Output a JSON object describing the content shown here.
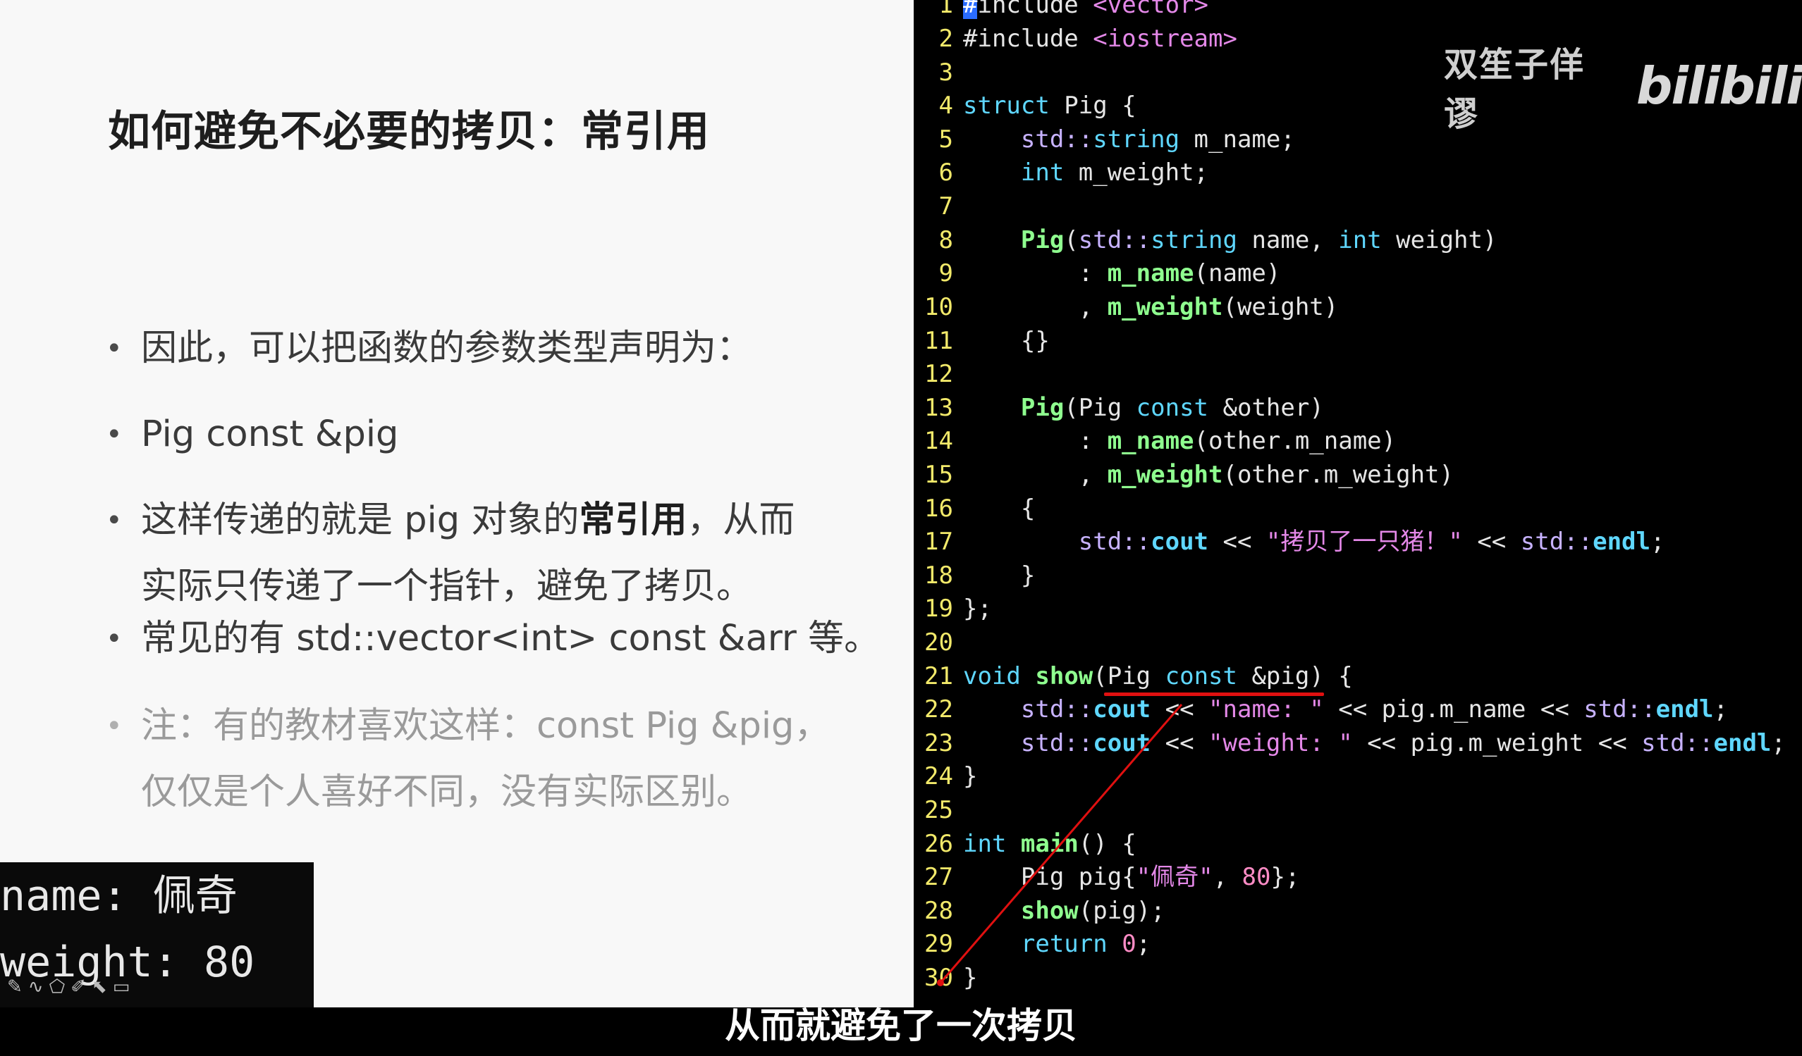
{
  "slide": {
    "title": "如何避免不必要的拷贝：常引用",
    "bullets": [
      {
        "text": "因此，可以把函数的参数类型声明为："
      },
      {
        "text": "Pig const &pig"
      },
      {
        "text_before": "这样传递的就是 pig 对象的",
        "text_bold": "常引用",
        "text_after": "，从而",
        "text_line2": "实际只传递了一个指针，避免了拷贝。"
      },
      {
        "text": "常见的有 std::vector<int> const &arr 等。"
      },
      {
        "text": "注：有的教材喜欢这样：const Pig &pig，",
        "text_line2": "仅仅是个人喜好不同，没有实际区别。"
      }
    ]
  },
  "console": {
    "line1": "name: 佩奇",
    "line2": "weight: 80",
    "tools": "✎∿⬠✐⬉▭"
  },
  "editor": {
    "lines": [
      {
        "n": "1",
        "raw": "#include <vector>"
      },
      {
        "n": "2",
        "raw": "#include <iostream>"
      },
      {
        "n": "3",
        "raw": ""
      },
      {
        "n": "4",
        "raw": "struct Pig {"
      },
      {
        "n": "5",
        "raw": "    std::string m_name;"
      },
      {
        "n": "6",
        "raw": "    int m_weight;"
      },
      {
        "n": "7",
        "raw": ""
      },
      {
        "n": "8",
        "raw": "    Pig(std::string name, int weight)"
      },
      {
        "n": "9",
        "raw": "        : m_name(name)"
      },
      {
        "n": "10",
        "raw": "        , m_weight(weight)"
      },
      {
        "n": "11",
        "raw": "    {}"
      },
      {
        "n": "12",
        "raw": ""
      },
      {
        "n": "13",
        "raw": "    Pig(Pig const &other)"
      },
      {
        "n": "14",
        "raw": "        : m_name(other.m_name)"
      },
      {
        "n": "15",
        "raw": "        , m_weight(other.m_weight)"
      },
      {
        "n": "16",
        "raw": "    {"
      },
      {
        "n": "17",
        "raw": "        std::cout << \"拷贝了一只猪！\" << std::endl;"
      },
      {
        "n": "18",
        "raw": "    }"
      },
      {
        "n": "19",
        "raw": "};"
      },
      {
        "n": "20",
        "raw": ""
      },
      {
        "n": "21",
        "raw": "void show(Pig const &pig) {"
      },
      {
        "n": "22",
        "raw": "    std::cout << \"name: \" << pig.m_name << std::endl;"
      },
      {
        "n": "23",
        "raw": "    std::cout << \"weight: \" << pig.m_weight << std::endl;"
      },
      {
        "n": "24",
        "raw": "}"
      },
      {
        "n": "25",
        "raw": ""
      },
      {
        "n": "26",
        "raw": "int main() {"
      },
      {
        "n": "27",
        "raw": "    Pig pig{\"佩奇\", 80};"
      },
      {
        "n": "28",
        "raw": "    show(pig);"
      },
      {
        "n": "29",
        "raw": "    return 0;"
      },
      {
        "n": "30",
        "raw": "}"
      }
    ]
  },
  "watermark": {
    "author": "双笙子佯谬",
    "logo": "bilibili"
  },
  "subtitle": "从而就避免了一次拷贝",
  "colors": {
    "slide_bg": "#f8f8f8",
    "editor_bg": "#000000",
    "line_number": "#f2e96a",
    "keyword": "#5fd7ff",
    "function": "#8fff8f",
    "string": "#e488e8",
    "number": "#ff8cc6",
    "annotation_red": "#e01010"
  }
}
